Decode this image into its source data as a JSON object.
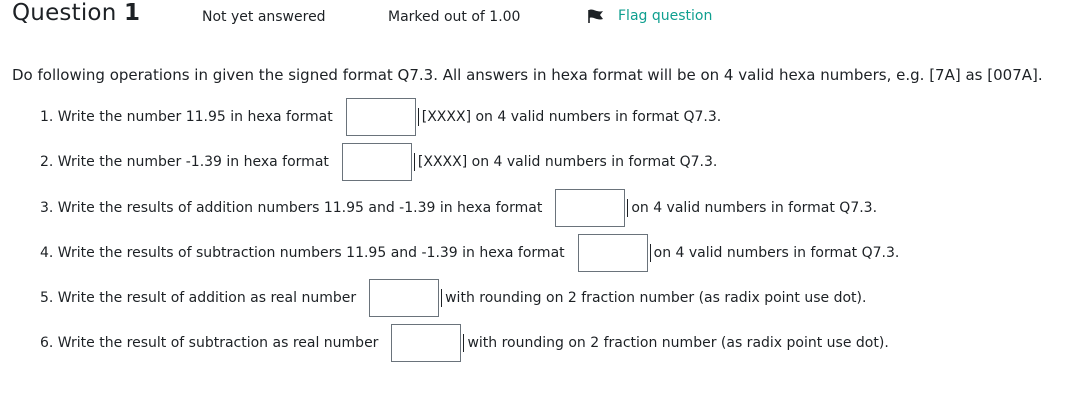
{
  "question": {
    "title_prefix": "Question",
    "number": "1",
    "state": "Not yet answered",
    "grade": "Marked out of 1.00",
    "flag_label": "Flag question"
  },
  "intro": "Do following operations in given the signed format Q7.3. All answers in hexa format will be on 4 valid hexa numbers, e.g. [7A] as [007A].",
  "items": [
    {
      "label": "1. Write the number 11.95 in hexa format",
      "value": "",
      "hint": "[XXXX] on 4 valid numbers in format Q7.3."
    },
    {
      "label": "2. Write the number -1.39 in hexa format",
      "value": "",
      "hint": "[XXXX] on 4 valid numbers in format Q7.3."
    },
    {
      "label": "3. Write the results of addition numbers 11.95 and -1.39 in hexa format",
      "value": "",
      "hint": "on 4 valid numbers in format Q7.3."
    },
    {
      "label": "4. Write the results of subtraction numbers 11.95 and -1.39 in hexa format",
      "value": "",
      "hint": "on 4 valid numbers in format Q7.3."
    },
    {
      "label": "5. Write the result of addition as real number",
      "value": "",
      "hint": "with rounding on 2 fraction number (as radix point use dot)."
    },
    {
      "label": "6. Write the result of subtraction as real number",
      "value": "",
      "hint": "with rounding on 2 fraction number (as radix point use dot)."
    }
  ],
  "colors": {
    "flag": "#0f9f8f",
    "text": "#1d2125",
    "input_border": "#6a737b"
  },
  "icons": {
    "flag": "flag-icon"
  }
}
